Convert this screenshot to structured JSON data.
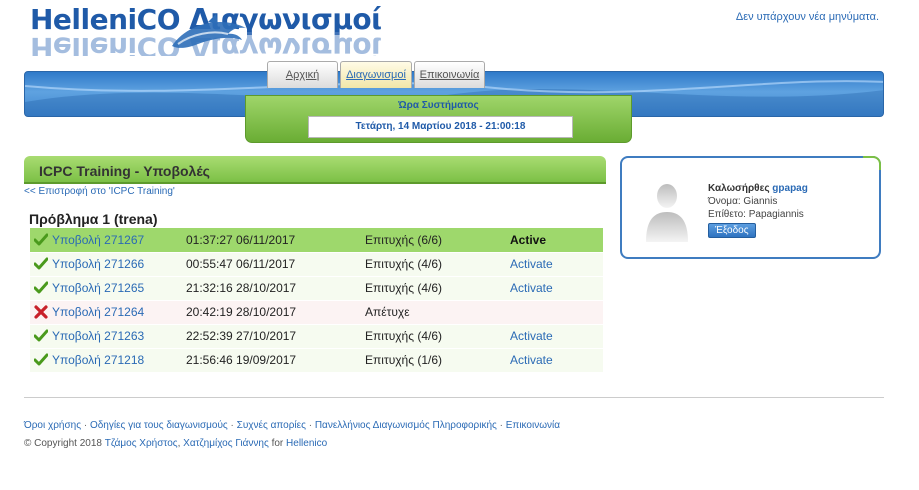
{
  "header": {
    "logo_text": "HelleniCO Διαγωνισμοί",
    "messages": "Δεν υπάρχουν νέα μηνύματα."
  },
  "nav": {
    "tabs": [
      {
        "label": "Αρχική",
        "active": false
      },
      {
        "label": "Διαγωνισμοί",
        "active": true
      },
      {
        "label": "Επικοινωνία",
        "active": false
      }
    ]
  },
  "clock": {
    "label": "Ώρα Συστήματος",
    "value": "Τετάρτη, 14 Μαρτίου 2018 - 21:00:18"
  },
  "main": {
    "title": "ICPC Training - Υποβολές",
    "back_link": "<< Επιστροφή στο 'ICPC Training'",
    "problem_title": "Πρόβλημα 1 (trena)",
    "submissions": [
      {
        "icon": "check-icon",
        "label": "Υποβολή 271267",
        "time": "01:37:27 06/11/2017",
        "status": "Επιτυχής (6/6)",
        "action": "Active",
        "state": "active"
      },
      {
        "icon": "check-icon",
        "label": "Υποβολή 271266",
        "time": "00:55:47 06/11/2017",
        "status": "Επιτυχής (4/6)",
        "action": "Activate",
        "state": "ok"
      },
      {
        "icon": "check-icon",
        "label": "Υποβολή 271265",
        "time": "21:32:16 28/10/2017",
        "status": "Επιτυχής (4/6)",
        "action": "Activate",
        "state": "ok"
      },
      {
        "icon": "cross-icon",
        "label": "Υποβολή 271264",
        "time": "20:42:19 28/10/2017",
        "status": "Απέτυχε",
        "action": "",
        "state": "fail"
      },
      {
        "icon": "check-icon",
        "label": "Υποβολή 271263",
        "time": "22:52:39 27/10/2017",
        "status": "Επιτυχής (4/6)",
        "action": "Activate",
        "state": "ok"
      },
      {
        "icon": "check-icon",
        "label": "Υποβολή 271218",
        "time": "21:56:46 19/09/2017",
        "status": "Επιτυχής (1/6)",
        "action": "Activate",
        "state": "ok"
      }
    ]
  },
  "user": {
    "greeting": "Καλωσήρθες",
    "username": "gpapag",
    "first_name_label": "Όνομα:",
    "first_name": "Giannis",
    "last_name_label": "Επίθετο:",
    "last_name": "Papagiannis",
    "logout_label": "Έξοδος"
  },
  "footer": {
    "links": [
      "Όροι χρήσης",
      "Οδηγίες για τους διαγωνισμούς",
      "Συχνές απορίες",
      "Πανελλήνιος Διαγωνισμός Πληροφορικής",
      "Επικοινωνία"
    ],
    "separator": "·",
    "copyright_prefix": "© Copyright 2018",
    "author1": "Τζάμος Χρήστος",
    "author_sep": ",",
    "author2": "Χατζημίχος Γιάννης",
    "for_text": "for",
    "org": "Hellenico"
  },
  "colors": {
    "link": "#2a6ab5",
    "green_header": "#7cc046",
    "active_row": "#9ed86c",
    "nav_blue": "#3f86cf"
  }
}
